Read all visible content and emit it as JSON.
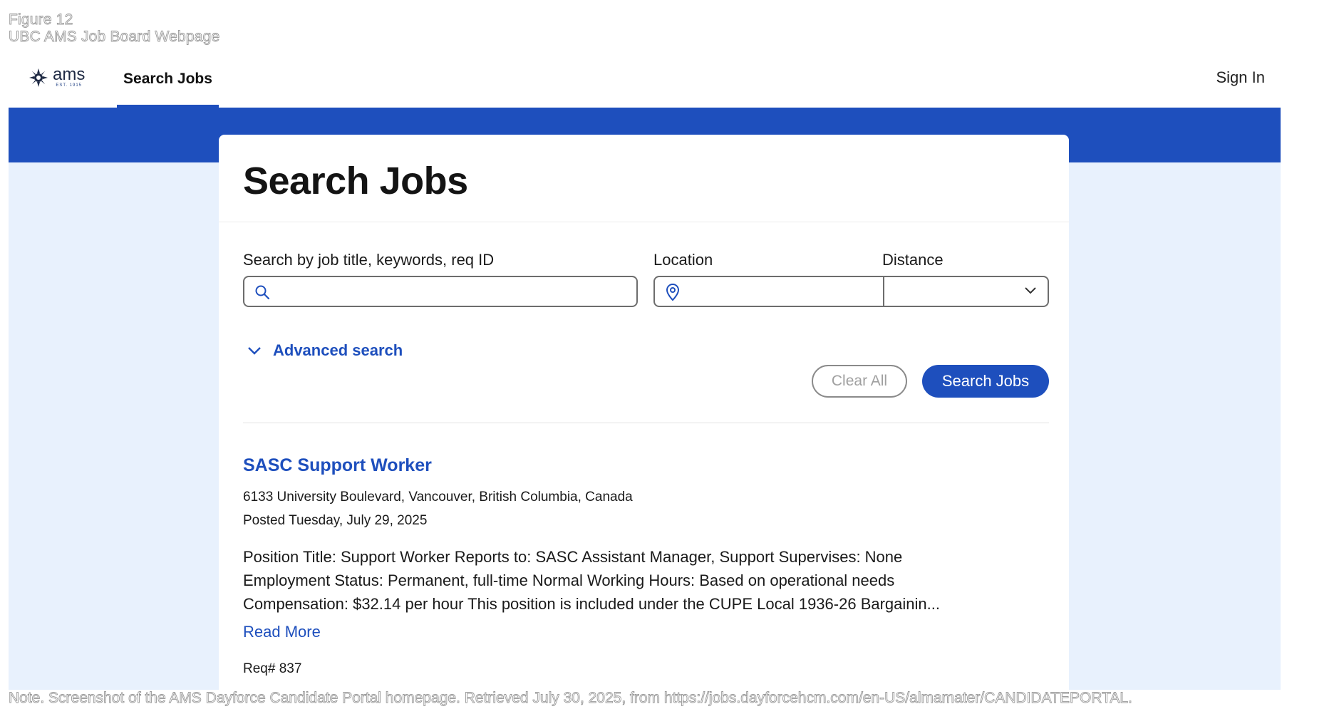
{
  "caption": {
    "figure_number": "Figure 12",
    "figure_title": "UBC AMS Job Board Webpage",
    "note": "Note. Screenshot of the AMS Dayforce Candidate Portal homepage. Retrieved July 30, 2025, from https://jobs.dayforcehcm.com/en-US/almamater/CANDIDATEPORTAL."
  },
  "header": {
    "logo_text": "ams",
    "logo_subtext": "EST. 1915",
    "nav_tab": "Search Jobs",
    "sign_in": "Sign In"
  },
  "search": {
    "title": "Search Jobs",
    "keyword_label": "Search by job title, keywords, req ID",
    "keyword_value": "",
    "location_label": "Location",
    "location_value": "",
    "distance_label": "Distance",
    "distance_value": "",
    "advanced_label": "Advanced search",
    "clear_label": "Clear All",
    "submit_label": "Search Jobs"
  },
  "jobs": [
    {
      "title": "SASC Support Worker",
      "location": "6133 University Boulevard, Vancouver, British Columbia, Canada",
      "posted": "Posted Tuesday, July 29, 2025",
      "description_lines": [
        "Position Title:  Support Worker Reports to:  SASC Assistant Manager, Support Supervises: None",
        "Employment Status: Permanent, full-time Normal Working Hours: Based on operational needs",
        "Compensation: $32.14 per hour This position is included under the CUPE Local 1936-26 Bargainin..."
      ],
      "read_more": "Read More",
      "req": "Req# 837"
    }
  ],
  "colors": {
    "brand_blue": "#1e4fbd",
    "page_bg": "#e8f1fd"
  },
  "icons": [
    "sun-logo-icon",
    "search-icon",
    "location-pin-icon",
    "chevron-down-icon"
  ]
}
